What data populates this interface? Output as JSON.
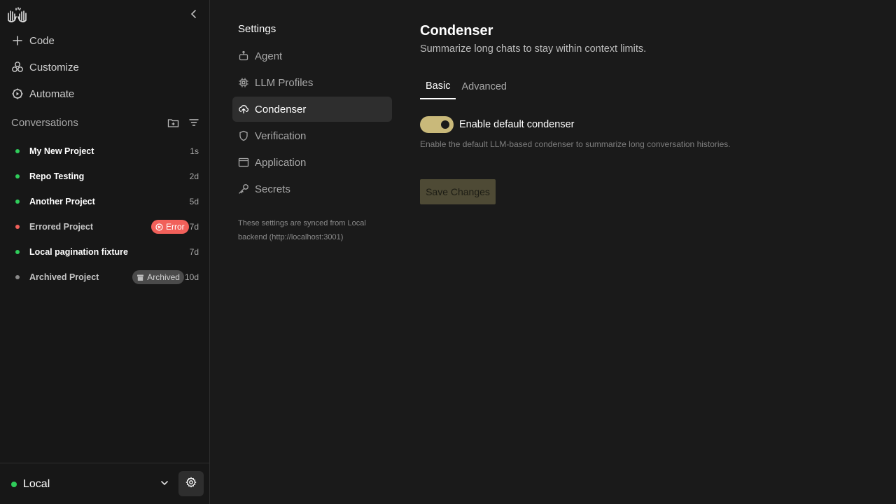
{
  "sidebar": {
    "logo_icon": "hands-logo-icon",
    "nav": [
      {
        "label": "Code",
        "icon": "plus-icon"
      },
      {
        "label": "Customize",
        "icon": "nodes-icon"
      },
      {
        "label": "Automate",
        "icon": "automate-gear-icon"
      }
    ],
    "conversations_title": "Conversations",
    "conversations": [
      {
        "name": "My New Project",
        "time": "1s",
        "status": "green"
      },
      {
        "name": "Repo Testing",
        "time": "2d",
        "status": "green"
      },
      {
        "name": "Another Project",
        "time": "5d",
        "status": "green"
      },
      {
        "name": "Errored Project",
        "time": "7d",
        "status": "red",
        "badge": "Error"
      },
      {
        "name": "Local pagination fixture",
        "time": "7d",
        "status": "green"
      },
      {
        "name": "Archived Project",
        "time": "10d",
        "status": "gray",
        "badge": "Archived"
      }
    ],
    "backend": {
      "name": "Local",
      "status_color": "#2fcc5a"
    }
  },
  "settings_nav": {
    "title": "Settings",
    "items": [
      {
        "label": "Agent",
        "icon": "robot-icon"
      },
      {
        "label": "LLM Profiles",
        "icon": "chip-icon"
      },
      {
        "label": "Condenser",
        "icon": "cloud-upload-icon",
        "active": true
      },
      {
        "label": "Verification",
        "icon": "shield-icon"
      },
      {
        "label": "Application",
        "icon": "window-icon"
      },
      {
        "label": "Secrets",
        "icon": "key-icon"
      }
    ],
    "sync_note": "These settings are synced from Local backend (http://localhost:3001)"
  },
  "content": {
    "title": "Condenser",
    "subtitle": "Summarize long chats to stay within context limits.",
    "tabs": [
      {
        "label": "Basic",
        "active": true
      },
      {
        "label": "Advanced",
        "active": false
      }
    ],
    "toggle": {
      "label": "Enable default condenser",
      "enabled": true,
      "help": "Enable the default LLM-based condenser to summarize long conversation histories."
    },
    "save_label": "Save Changes"
  },
  "colors": {
    "accent": "#c9b97a",
    "green": "#2fcc5a",
    "red": "#f1605a",
    "gray": "#8a8a8a"
  }
}
